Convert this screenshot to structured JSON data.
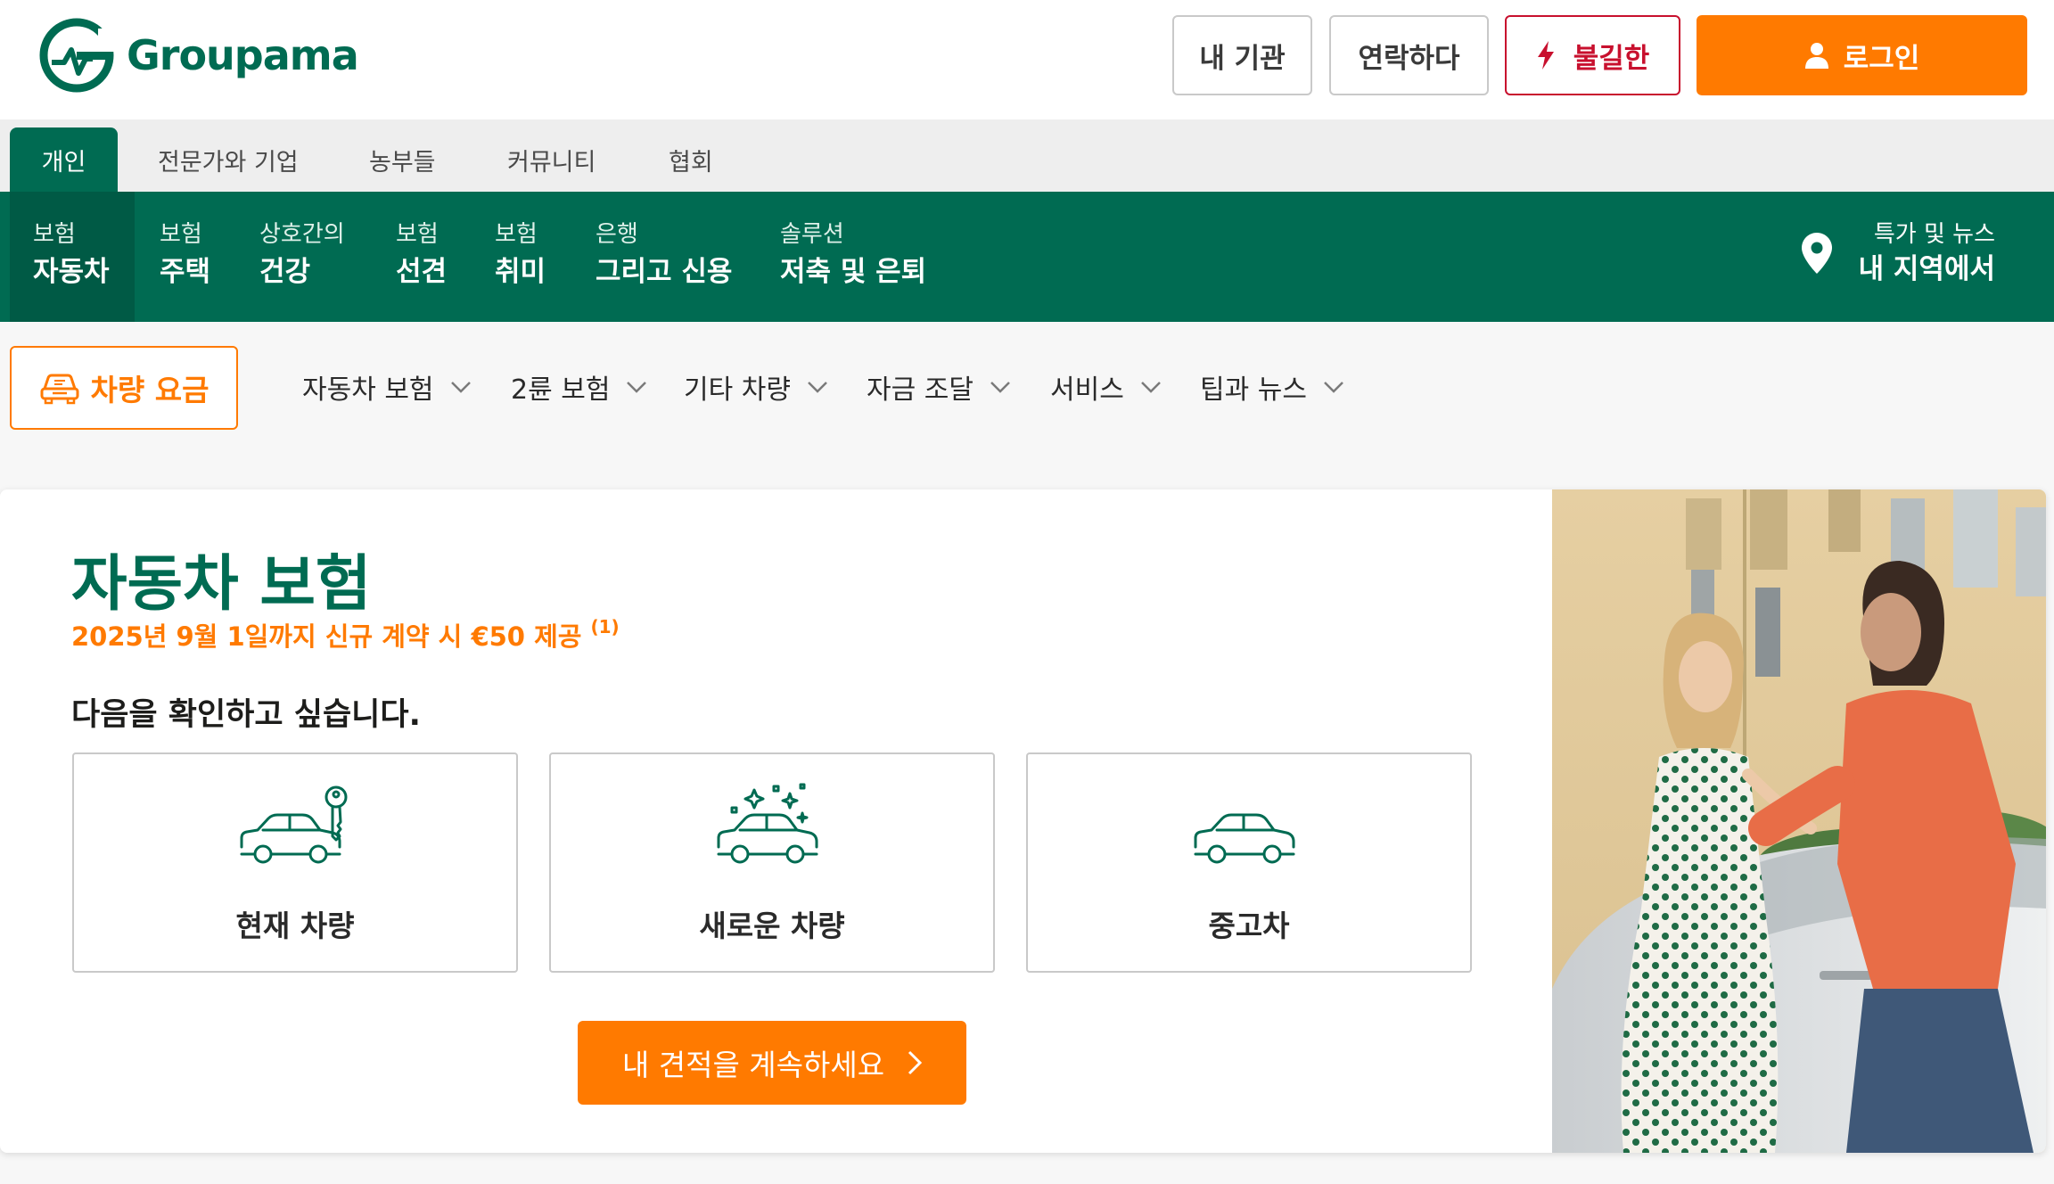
{
  "header": {
    "brand": "Groupama",
    "agency_label": "내 기관",
    "contact_label": "연락하다",
    "claim_label": "불길한",
    "login_label": "로그인"
  },
  "segments": [
    {
      "label": "개인",
      "active": true
    },
    {
      "label": "전문가와 기업"
    },
    {
      "label": "농부들"
    },
    {
      "label": "커뮤니티"
    },
    {
      "label": "협회"
    }
  ],
  "mainnav": {
    "items": [
      {
        "line1": "보험",
        "line2": "자동차",
        "active": true
      },
      {
        "line1": "보험",
        "line2": "주택"
      },
      {
        "line1": "상호간의",
        "line2": "건강"
      },
      {
        "line1": "보험",
        "line2": "선견"
      },
      {
        "line1": "보험",
        "line2": "취미"
      },
      {
        "line1": "은행",
        "line2": "그리고 신용"
      },
      {
        "line1": "솔루션",
        "line2": "저축 및 은퇴"
      }
    ],
    "regional": {
      "line1": "특가 및 뉴스",
      "line2": "내 지역에서"
    }
  },
  "subnav": {
    "tarif_label": "차량 요금",
    "items": [
      "자동차 보험",
      "2륜 보험",
      "기타 차량",
      "자금 조달",
      "서비스",
      "팁과 뉴스"
    ]
  },
  "hero": {
    "title": "자동차 보험",
    "offer": "2025년 9월 1일까지 신규 계약 시 €50 제공",
    "offer_note": "(1)",
    "prompt": "다음을 확인하고 싶습니다.",
    "choices": [
      {
        "label": "현재 차량",
        "icon": "car-key-icon"
      },
      {
        "label": "새로운 차량",
        "icon": "new-car-sparkle-icon"
      },
      {
        "label": "중고차",
        "icon": "car-icon"
      }
    ],
    "continue_label": "내 견적을 계속하세요"
  },
  "colors": {
    "brand_green": "#006b52",
    "accent_orange": "#ff7a00",
    "claim_red": "#c8102e"
  }
}
